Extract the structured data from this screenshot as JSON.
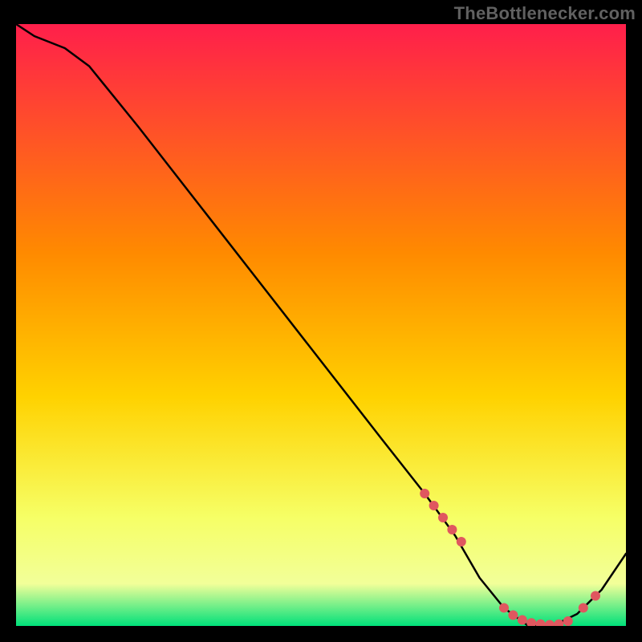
{
  "attribution": "TheBottlenecker.com",
  "chart_data": {
    "type": "line",
    "title": "",
    "xlabel": "",
    "ylabel": "",
    "xlim": [
      0,
      100
    ],
    "ylim": [
      0,
      100
    ],
    "x": [
      0,
      3,
      8,
      12,
      20,
      30,
      40,
      50,
      60,
      67,
      72,
      76,
      80,
      84,
      88,
      92,
      96,
      100
    ],
    "y": [
      100,
      98,
      96,
      93,
      83,
      70,
      57,
      44,
      31,
      22,
      15,
      8,
      3,
      0,
      0,
      2,
      6,
      12
    ],
    "markers_x": [
      67,
      68.5,
      70,
      71.5,
      73,
      80,
      81.5,
      83,
      84.5,
      86,
      87.5,
      89,
      90.5,
      93,
      95
    ],
    "markers_y": [
      22,
      20,
      18,
      16,
      14,
      3,
      1.8,
      1,
      0.5,
      0.3,
      0.2,
      0.3,
      0.8,
      3,
      5
    ],
    "colors": {
      "gradient_top": "#ff1f4b",
      "gradient_mid": "#ffd200",
      "gradient_low": "#f2ff99",
      "gradient_bottom": "#00e07a",
      "curve": "#000000",
      "marker": "#e0575f"
    }
  }
}
